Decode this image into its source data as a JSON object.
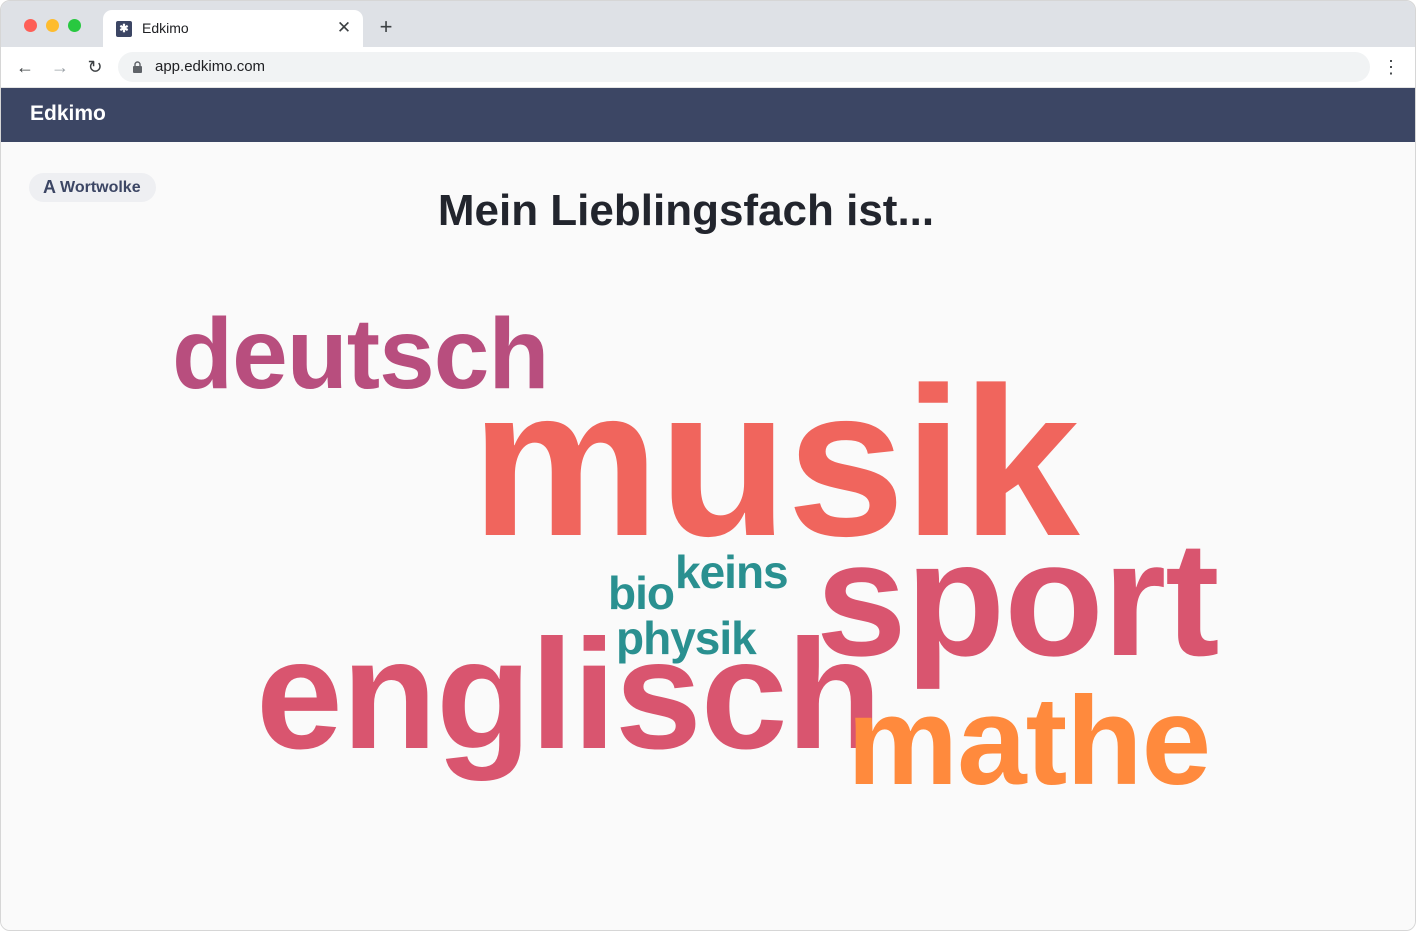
{
  "browser": {
    "tab_title": "Edkimo",
    "tab_close_icon": "close-icon",
    "new_tab_icon": "plus-icon",
    "url": "app.edkimo.com"
  },
  "app": {
    "brand": "Edkimo",
    "header_color": "#3c4664"
  },
  "activity": {
    "type_label": "Wortwolke",
    "type_icon": "font-a-icon",
    "question": "Mein Lieblingsfach ist..."
  },
  "word_cloud": [
    {
      "text": "deutsch",
      "color": "#b84e7e"
    },
    {
      "text": "musik",
      "color": "#f0655d"
    },
    {
      "text": "keins",
      "color": "#2a9090"
    },
    {
      "text": "bio",
      "color": "#2a9090"
    },
    {
      "text": "sport",
      "color": "#d9556f"
    },
    {
      "text": "physik",
      "color": "#2a9090"
    },
    {
      "text": "englisch",
      "color": "#d9556f"
    },
    {
      "text": "mathe",
      "color": "#ff8a3d"
    }
  ]
}
